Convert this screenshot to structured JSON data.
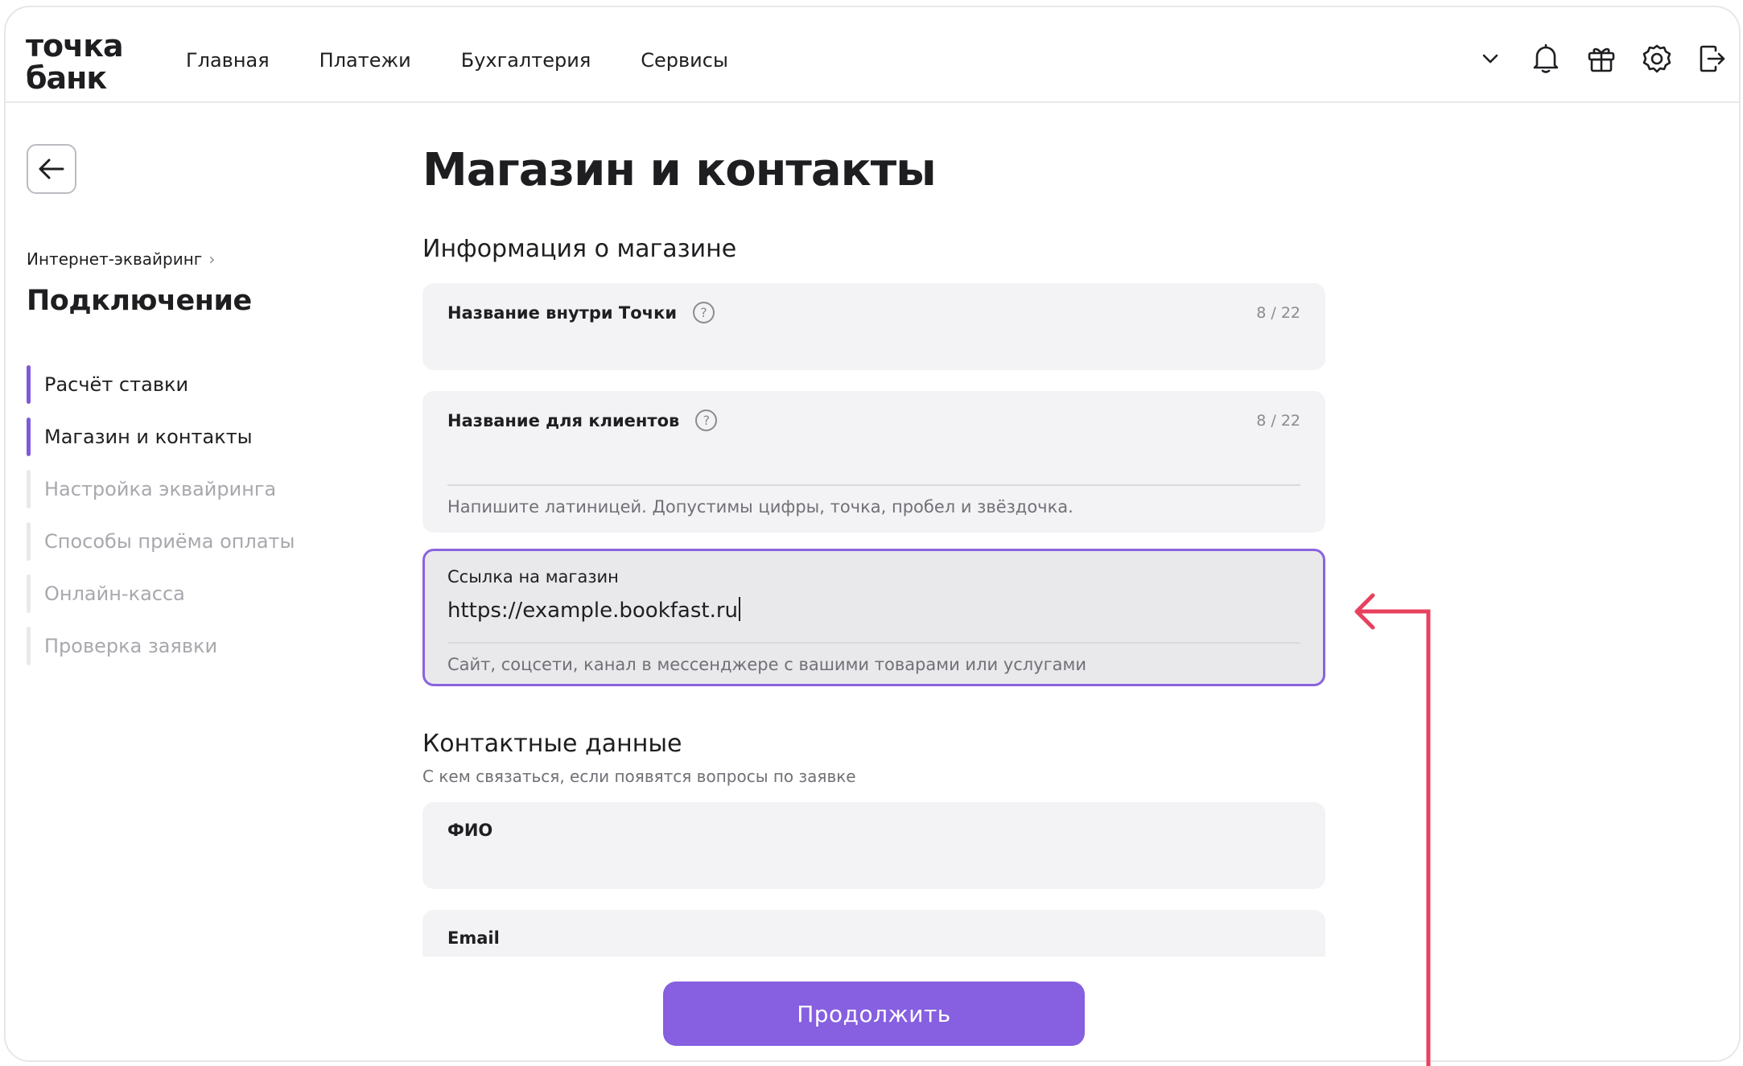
{
  "header": {
    "logo_line1": "точка",
    "logo_line2": "банк",
    "nav": [
      "Главная",
      "Платежи",
      "Бухгалтерия",
      "Сервисы"
    ],
    "icons": [
      "chevron-down-icon",
      "bell-icon",
      "gift-icon",
      "gear-icon",
      "logout-icon"
    ]
  },
  "sidebar": {
    "breadcrumb": "Интернет-эквайринг",
    "title": "Подключение",
    "steps": [
      {
        "label": "Расчёт ставки",
        "state": "done"
      },
      {
        "label": "Магазин и контакты",
        "state": "current"
      },
      {
        "label": "Настройка эквайринга",
        "state": "pending"
      },
      {
        "label": "Способы приёма оплаты",
        "state": "pending"
      },
      {
        "label": "Онлайн-касса",
        "state": "pending"
      },
      {
        "label": "Проверка заявки",
        "state": "pending"
      }
    ]
  },
  "main": {
    "title": "Магазин и контакты",
    "shop_section": {
      "title": "Информация о магазине",
      "internal_name": {
        "label": "Название внутри Точки",
        "counter": "8 / 22"
      },
      "client_name": {
        "label": "Название для клиентов",
        "counter": "8 / 22",
        "hint": "Напишите латиницей. Допустимы цифры, точка, пробел и звёздочка."
      },
      "shop_link": {
        "label": "Ссылка на магазин",
        "value": "https://example.bookfast.ru",
        "hint": "Сайт, соцсети, канал в мессенджере с вашими товарами или услугами"
      }
    },
    "contacts_section": {
      "title": "Контактные данные",
      "subtitle": "С кем связаться, если появятся вопросы по заявке",
      "full_name": {
        "label": "ФИО"
      },
      "email": {
        "label": "Email"
      }
    },
    "continue_label": "Продолжить"
  },
  "colors": {
    "accent": "#8660e0",
    "focus_border": "#8a63dc",
    "step_active": "#7d5bd9",
    "annotation_arrow": "#e8415e"
  }
}
